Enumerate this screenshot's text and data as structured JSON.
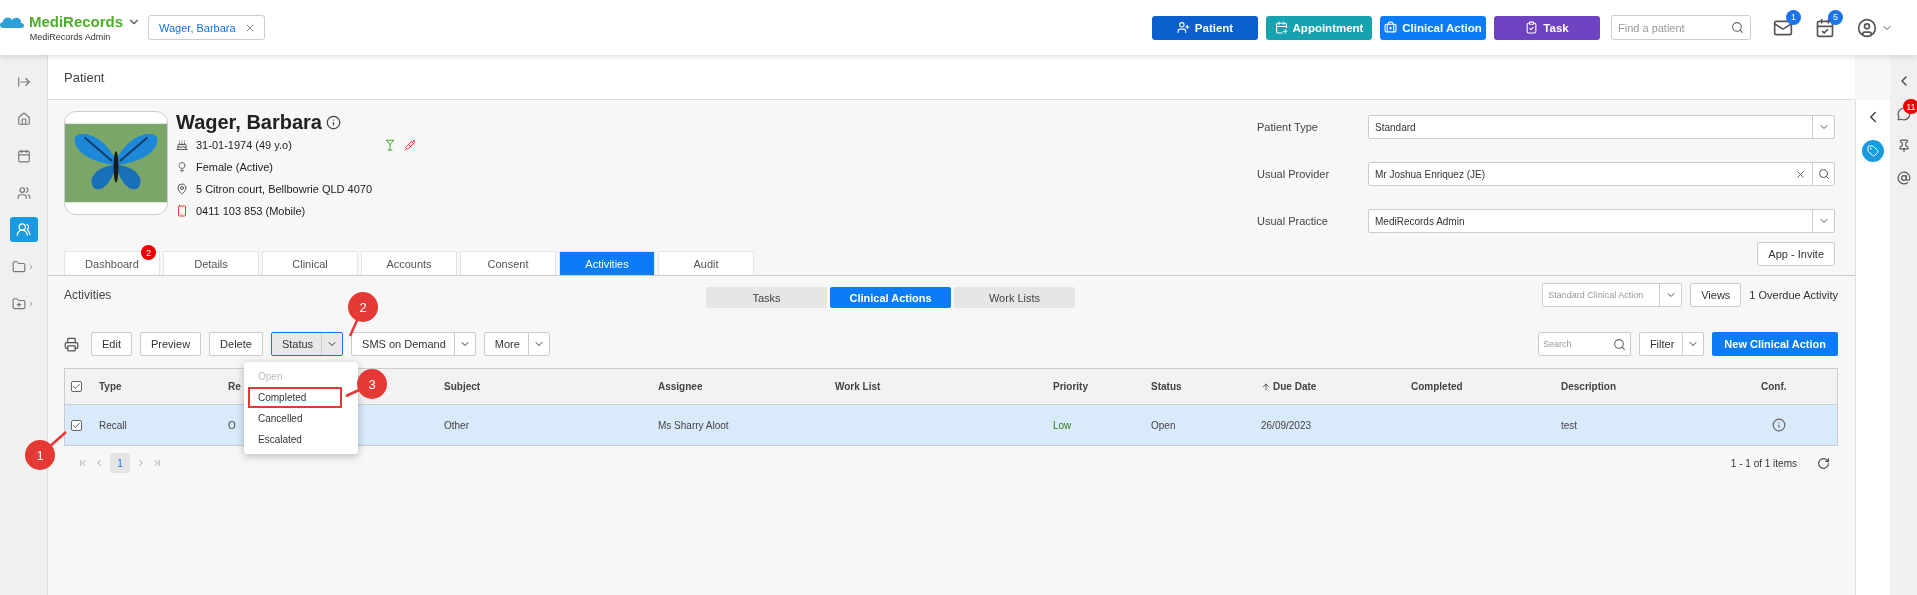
{
  "header": {
    "logo": "MediRecords",
    "subtitle": "MediRecords Admin",
    "open_tab": "Wager, Barbara",
    "buttons": [
      {
        "label": "Patient",
        "color": "#0a5fcc",
        "kind": "patient"
      },
      {
        "label": "Appointment",
        "color": "#17a2b0",
        "kind": "appointment"
      },
      {
        "label": "Clinical Action",
        "color": "#0a7cf5",
        "kind": "clinical"
      },
      {
        "label": "Task",
        "color": "#6f42c1",
        "kind": "task"
      }
    ],
    "search": {
      "placeholder": "Find a patient"
    },
    "mail_count": "1",
    "task_count": "5"
  },
  "page_title": "Patient",
  "patient": {
    "name": "Wager, Barbara",
    "dob": "31-01-1974 (49 y.o)",
    "gender": "Female (Active)",
    "address": "5 Citron court, Bellbowrie QLD 4070",
    "phone": "0411 103 853 (Mobile)"
  },
  "fields": [
    {
      "label": "Patient Type",
      "value": "Standard",
      "kind": "select"
    },
    {
      "label": "Usual Provider",
      "value": "Mr Joshua Enriquez (JE)",
      "kind": "lookup"
    },
    {
      "label": "Usual Practice",
      "value": "MediRecords Admin",
      "kind": "select"
    }
  ],
  "invite_button": "App - Invite",
  "tabs": [
    {
      "label": "Dashboard",
      "selected": false,
      "badge": "2"
    },
    {
      "label": "Details",
      "selected": false
    },
    {
      "label": "Clinical",
      "selected": false
    },
    {
      "label": "Accounts",
      "selected": false
    },
    {
      "label": "Consent",
      "selected": false
    },
    {
      "label": "Activities",
      "selected": true
    },
    {
      "label": "Audit",
      "selected": false
    }
  ],
  "activities": {
    "title": "Activities",
    "subtabs": [
      {
        "label": "Tasks",
        "selected": false
      },
      {
        "label": "Clinical Actions",
        "selected": true
      },
      {
        "label": "Work Lists",
        "selected": false
      }
    ],
    "view_select": {
      "placeholder": "Standard Clinical Action"
    },
    "views_button": "Views",
    "overdue": "1 Overdue Activity",
    "toolbar": [
      {
        "label": "Edit",
        "kind": "button",
        "selected": false
      },
      {
        "label": "Preview",
        "kind": "button",
        "selected": false
      },
      {
        "label": "Delete",
        "kind": "button",
        "selected": false
      },
      {
        "label": "Status",
        "kind": "split",
        "selected": true
      },
      {
        "label": "SMS on Demand",
        "kind": "split",
        "selected": false
      },
      {
        "label": "More",
        "kind": "split",
        "selected": false
      }
    ],
    "search": {
      "placeholder": "Search"
    },
    "filter": "Filter",
    "new_button": "New Clinical Action",
    "table": {
      "all_checked": true,
      "columns": [
        {
          "label": "Type",
          "sorted": false
        },
        {
          "label": "Re",
          "sorted": false
        },
        {
          "label": "Subject",
          "sorted": false
        },
        {
          "label": "Assignee",
          "sorted": false
        },
        {
          "label": "Work List",
          "sorted": false
        },
        {
          "label": "Priority",
          "sorted": false
        },
        {
          "label": "Status",
          "sorted": false
        },
        {
          "label": "Due Date",
          "sorted": true
        },
        {
          "label": "Completed",
          "sorted": false
        },
        {
          "label": "Description",
          "sorted": false
        },
        {
          "label": "Conf.",
          "sorted": false
        }
      ],
      "rows": [
        {
          "checked": true,
          "selected": true,
          "cells": [
            {
              "kind": "text",
              "text": "Recall"
            },
            {
              "kind": "text",
              "text": "O"
            },
            {
              "kind": "text",
              "text": "Other"
            },
            {
              "kind": "text",
              "text": "Ms Sharry Aloot"
            },
            {
              "kind": "empty"
            },
            {
              "kind": "priority",
              "text": "Low"
            },
            {
              "kind": "text",
              "text": "Open"
            },
            {
              "kind": "text",
              "text": "26/09/2023"
            },
            {
              "kind": "empty"
            },
            {
              "kind": "text",
              "text": "test"
            },
            {
              "kind": "info"
            }
          ]
        }
      ]
    },
    "pager": {
      "page": "1",
      "summary": "1 - 1 of 1 items"
    }
  },
  "status_menu": {
    "items": [
      {
        "label": "Open",
        "disabled": true,
        "highlighted": false
      },
      {
        "label": "Completed",
        "disabled": false,
        "highlighted": true
      },
      {
        "label": "Cancelled",
        "disabled": false,
        "highlighted": false
      },
      {
        "label": "Escalated",
        "disabled": false,
        "highlighted": false
      }
    ]
  },
  "callouts": [
    "1",
    "2",
    "3"
  ],
  "side_panel": {
    "chat_badge": "11"
  }
}
